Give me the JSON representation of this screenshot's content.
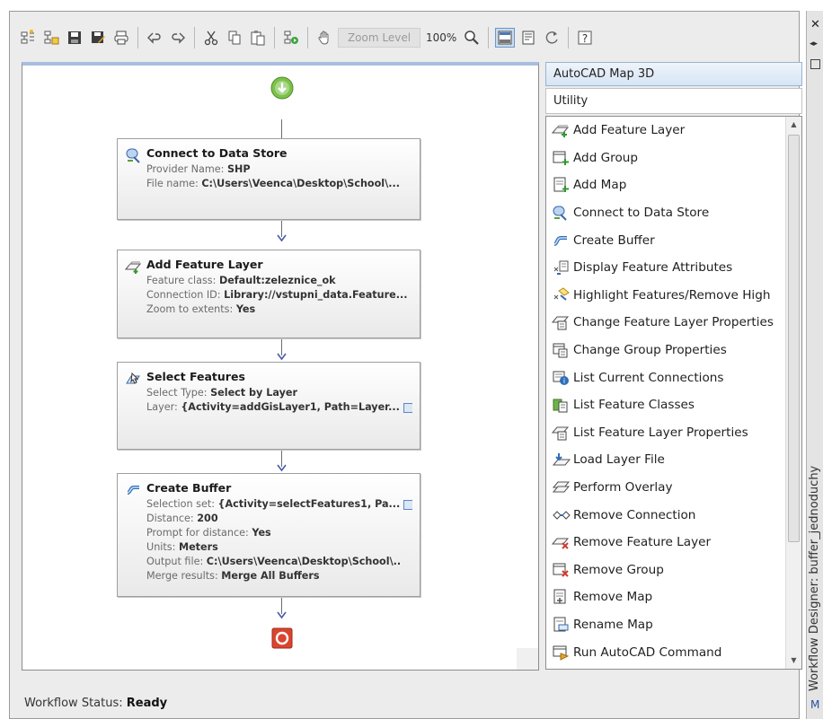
{
  "toolbar": {
    "zoom_level_placeholder": "Zoom Level",
    "zoom_percent": "100%"
  },
  "workflow": {
    "nodes": [
      {
        "title": "Connect to Data Store",
        "props": [
          {
            "label": "Provider Name:",
            "value": "SHP"
          },
          {
            "label": "File name:",
            "value": "C:\\Users\\Veenca\\Desktop\\School\\..."
          }
        ]
      },
      {
        "title": "Add Feature Layer",
        "props": [
          {
            "label": "Feature class:",
            "value": "Default:zeleznice_ok"
          },
          {
            "label": "Connection ID:",
            "value": "Library://vstupni_data.Feature..."
          },
          {
            "label": "Zoom to extents:",
            "value": "Yes"
          }
        ]
      },
      {
        "title": "Select Features",
        "props": [
          {
            "label": "Select Type:",
            "value": "Select by Layer"
          },
          {
            "label": "Layer:",
            "value": "{Activity=addGisLayer1, Path=Layer..."
          }
        ]
      },
      {
        "title": "Create Buffer",
        "props": [
          {
            "label": "Selection set:",
            "value": "{Activity=selectFeatures1, Pa..."
          },
          {
            "label": "Distance:",
            "value": "200"
          },
          {
            "label": "Prompt for distance:",
            "value": "Yes"
          },
          {
            "label": "Units:",
            "value": "Meters"
          },
          {
            "label": "Output file:",
            "value": "C:\\Users\\Veenca\\Desktop\\School\\.."
          },
          {
            "label": "Merge results:",
            "value": "Merge All Buffers"
          }
        ]
      }
    ]
  },
  "panel": {
    "header": "AutoCAD Map 3D",
    "category": "Utility",
    "items": [
      {
        "label": "Add Feature Layer",
        "icon": "add-feature-layer-icon"
      },
      {
        "label": "Add Group",
        "icon": "add-group-icon"
      },
      {
        "label": "Add Map",
        "icon": "add-map-icon"
      },
      {
        "label": "Connect to Data Store",
        "icon": "connect-data-store-icon"
      },
      {
        "label": "Create Buffer",
        "icon": "create-buffer-icon"
      },
      {
        "label": "Display Feature Attributes",
        "icon": "display-attributes-icon"
      },
      {
        "label": "Highlight Features/Remove High",
        "icon": "highlight-features-icon"
      },
      {
        "label": "Change Feature Layer Properties",
        "icon": "change-layer-properties-icon"
      },
      {
        "label": "Change Group Properties",
        "icon": "change-group-properties-icon"
      },
      {
        "label": "List Current Connections",
        "icon": "list-connections-icon"
      },
      {
        "label": "List Feature Classes",
        "icon": "list-feature-classes-icon"
      },
      {
        "label": "List Feature Layer Properties",
        "icon": "list-layer-properties-icon"
      },
      {
        "label": "Load Layer File",
        "icon": "load-layer-file-icon"
      },
      {
        "label": "Perform Overlay",
        "icon": "perform-overlay-icon"
      },
      {
        "label": "Remove Connection",
        "icon": "remove-connection-icon"
      },
      {
        "label": "Remove Feature Layer",
        "icon": "remove-feature-layer-icon"
      },
      {
        "label": "Remove Group",
        "icon": "remove-group-icon"
      },
      {
        "label": "Remove Map",
        "icon": "remove-map-icon"
      },
      {
        "label": "Rename Map",
        "icon": "rename-map-icon"
      },
      {
        "label": "Run AutoCAD Command",
        "icon": "run-command-icon"
      }
    ]
  },
  "side": {
    "title": "Workflow Designer: buffer_jednoduchy",
    "m_label": "M"
  },
  "status": {
    "label": "Workflow Status:",
    "value": "Ready"
  },
  "colors": {
    "panel_header_bg": "#d7e5f4",
    "start_node": "#7cc24a",
    "end_node": "#d9452f",
    "pick_button": "#5e86c2"
  }
}
